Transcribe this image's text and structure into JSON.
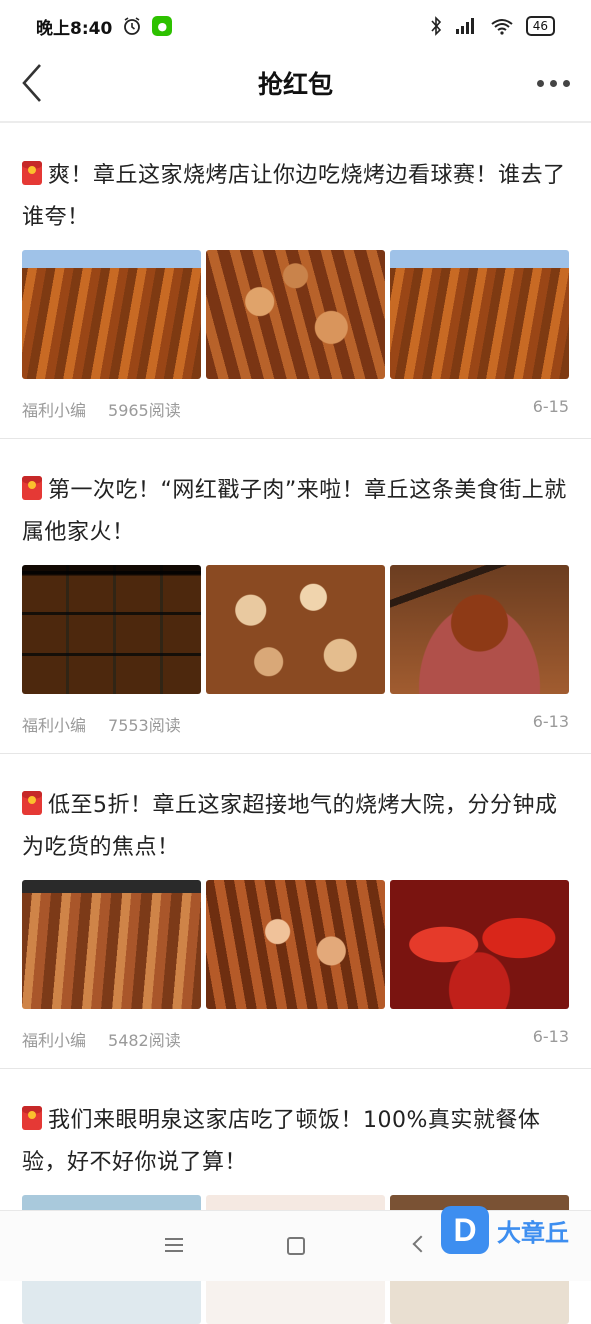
{
  "status_bar": {
    "time": "晚上8:40",
    "battery": "46"
  },
  "header": {
    "title": "抢红包"
  },
  "articles": [
    {
      "title": "爽！章丘这家烧烤店让你边吃烧烤边看球赛！谁去了谁夸！",
      "author": "福利小编",
      "reads": "5965阅读",
      "date": "6-15"
    },
    {
      "title": "第一次吃！“网红戳子肉”来啦！章丘这条美食街上就属他家火！",
      "author": "福利小编",
      "reads": "7553阅读",
      "date": "6-13"
    },
    {
      "title": "低至5折！章丘这家超接地气的烧烤大院，分分钟成为吃货的焦点！",
      "author": "福利小编",
      "reads": "5482阅读",
      "date": "6-13"
    },
    {
      "title": "我们来眼明泉这家店吃了顿饭！100%真实就餐体验，好不好你说了算！"
    }
  ],
  "watermark": {
    "logo_letter": "D",
    "text": "大章丘"
  },
  "icons": [
    "alarm-icon",
    "wechat-icon",
    "bluetooth-icon",
    "signal-icon",
    "wifi-icon",
    "battery-icon",
    "back-icon",
    "more-icon",
    "redpack-icon",
    "menu-icon",
    "home-icon",
    "nav-back-icon"
  ],
  "colors": {
    "accent": "#e53935",
    "watermark": "#3d8ef0"
  }
}
